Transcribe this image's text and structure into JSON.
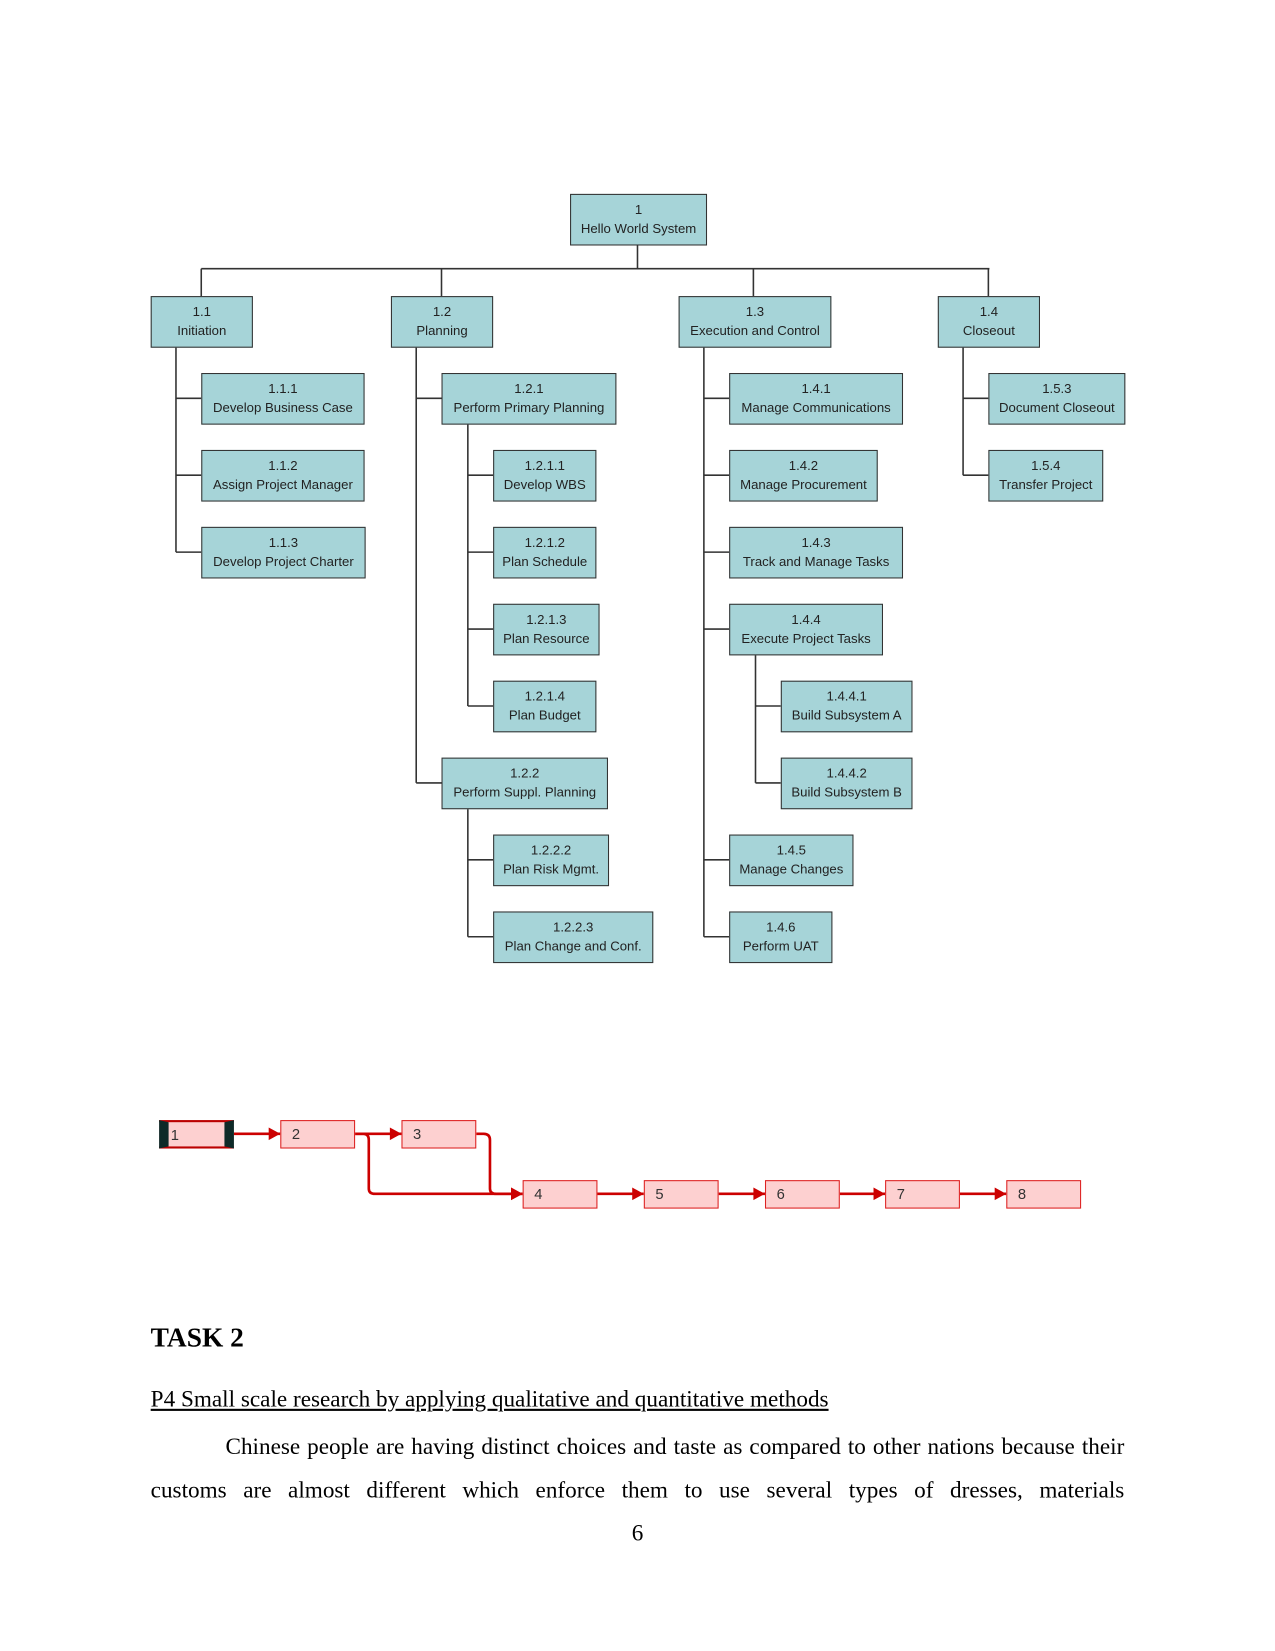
{
  "wbs": {
    "nodes": [
      {
        "id": "1",
        "label": "Hello World System"
      },
      {
        "id": "1.1",
        "label": "Initiation"
      },
      {
        "id": "1.2",
        "label": "Planning"
      },
      {
        "id": "1.3",
        "label": "Execution and Control"
      },
      {
        "id": "1.4",
        "label": "Closeout"
      },
      {
        "id": "1.1.1",
        "label": "Develop Business Case"
      },
      {
        "id": "1.1.2",
        "label": "Assign Project Manager"
      },
      {
        "id": "1.1.3",
        "label": "Develop Project Charter"
      },
      {
        "id": "1.2.1",
        "label": "Perform Primary Planning"
      },
      {
        "id": "1.2.1.1",
        "label": "Develop WBS"
      },
      {
        "id": "1.2.1.2",
        "label": "Plan Schedule"
      },
      {
        "id": "1.2.1.3",
        "label": "Plan Resource"
      },
      {
        "id": "1.2.1.4",
        "label": "Plan Budget"
      },
      {
        "id": "1.2.2",
        "label": "Perform Suppl. Planning"
      },
      {
        "id": "1.2.2.2",
        "label": "Plan Risk Mgmt."
      },
      {
        "id": "1.2.2.3",
        "label": "Plan Change and Conf."
      },
      {
        "id": "1.4.1",
        "label": "Manage Communications"
      },
      {
        "id": "1.4.2",
        "label": "Manage Procurement"
      },
      {
        "id": "1.4.3",
        "label": "Track and Manage Tasks"
      },
      {
        "id": "1.4.4",
        "label": "Execute Project Tasks"
      },
      {
        "id": "1.4.4.1",
        "label": "Build Subsystem A"
      },
      {
        "id": "1.4.4.2",
        "label": "Build Subsystem B"
      },
      {
        "id": "1.4.5",
        "label": "Manage Changes"
      },
      {
        "id": "1.4.6",
        "label": "Perform UAT"
      },
      {
        "id": "1.5.3",
        "label": "Document Closeout"
      },
      {
        "id": "1.5.4",
        "label": "Transfer Project"
      }
    ],
    "box_color": "#a6d4d8"
  },
  "network": {
    "tasks": [
      "1",
      "2",
      "3",
      "4",
      "5",
      "6",
      "7",
      "8"
    ],
    "dependencies": [
      [
        "1",
        "2"
      ],
      [
        "2",
        "3"
      ],
      [
        "2",
        "4"
      ],
      [
        "3",
        "4"
      ],
      [
        "4",
        "5"
      ],
      [
        "5",
        "6"
      ],
      [
        "6",
        "7"
      ],
      [
        "7",
        "8"
      ]
    ],
    "line_color": "#cc0000",
    "box_color": "#fdd0d0"
  },
  "document": {
    "task_title": "TASK 2",
    "subheading": "P4 Small scale research by applying qualitative and quantitative methods",
    "paragraph": "Chinese people are having distinct choices and taste as compared to other nations because their customs are almost different which enforce them to use several types of dresses, materials",
    "page_number": "6"
  }
}
